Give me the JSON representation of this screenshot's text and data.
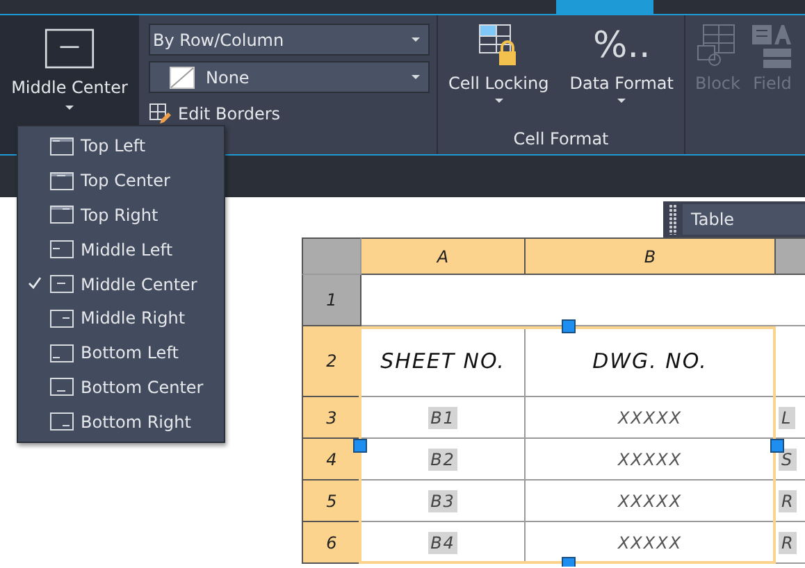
{
  "ribbon": {
    "alignment_button": {
      "label": "Middle Center"
    },
    "cell_style_dropdown": {
      "value": "By Row/Column"
    },
    "background_fill_dropdown": {
      "value": "None"
    },
    "edit_borders": {
      "label": "Edit Borders"
    },
    "cell_format": {
      "title": "Cell Format",
      "buttons": [
        {
          "label": "Cell Locking",
          "kind": "locking"
        },
        {
          "label": "Data Format",
          "kind": "format",
          "icon_text": "%.."
        }
      ]
    },
    "insert_buttons": [
      {
        "label": "Block",
        "kind": "block",
        "disabled": true
      },
      {
        "label": "Field",
        "kind": "field",
        "disabled": true
      }
    ]
  },
  "alignment_menu": [
    {
      "label": "Top Left",
      "kind": "top_left",
      "selected": false
    },
    {
      "label": "Top Center",
      "kind": "top_center",
      "selected": false
    },
    {
      "label": "Top Right",
      "kind": "top_right",
      "selected": false
    },
    {
      "label": "Middle Left",
      "kind": "middle_left",
      "selected": false
    },
    {
      "label": "Middle Center",
      "kind": "middle_center",
      "selected": true
    },
    {
      "label": "Middle Right",
      "kind": "middle_right",
      "selected": false
    },
    {
      "label": "Bottom Left",
      "kind": "bottom_left",
      "selected": false
    },
    {
      "label": "Bottom Center",
      "kind": "bottom_center",
      "selected": false
    },
    {
      "label": "Bottom Right",
      "kind": "bottom_right",
      "selected": false
    }
  ],
  "table_toolbar": {
    "label": "Table"
  },
  "table": {
    "columns": [
      {
        "label": "A",
        "selected": true
      },
      {
        "label": "B",
        "selected": true
      },
      {
        "selected": false
      }
    ],
    "rows": [
      {
        "number": "1",
        "selected": false,
        "cells": []
      },
      {
        "number": "2",
        "selected": true,
        "cells": [
          {
            "text": "SHEET  NO.",
            "field": false
          },
          {
            "text": "DWG.  NO.",
            "field": false
          },
          {}
        ]
      },
      {
        "number": "3",
        "selected": true,
        "cells": [
          {
            "text": "B1",
            "field": true
          },
          {
            "text": "XXXXX",
            "field": false
          },
          {
            "text": "L",
            "field": true
          }
        ]
      },
      {
        "number": "4",
        "selected": true,
        "cells": [
          {
            "text": "B2",
            "field": true
          },
          {
            "text": "XXXXX",
            "field": false
          },
          {
            "text": "S",
            "field": true
          }
        ]
      },
      {
        "number": "5",
        "selected": true,
        "cells": [
          {
            "text": "B3",
            "field": true
          },
          {
            "text": "XXXXX",
            "field": false
          },
          {
            "text": "R",
            "field": true
          }
        ]
      },
      {
        "number": "6",
        "selected": true,
        "cells": [
          {
            "text": "B4",
            "field": true
          },
          {
            "text": "XXXXX",
            "field": false
          },
          {
            "text": "R",
            "field": true
          }
        ]
      }
    ]
  }
}
